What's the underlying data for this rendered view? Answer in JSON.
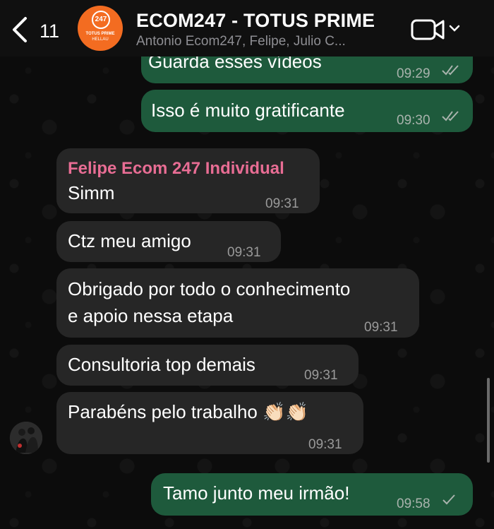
{
  "header": {
    "back_count": "11",
    "title": "ECOM247 - TOTUS PRIME",
    "subtitle": "Antonio Ecom247, Felipe, Julio C...",
    "avatar": {
      "logo_number": "247",
      "logo_line1": "TOTUS PRIME",
      "logo_line2": "HELLAU",
      "color": "#f36c21"
    },
    "icons": {
      "back": "chevron-left-icon",
      "video": "video-camera-icon",
      "menu": "chevron-down-icon"
    }
  },
  "colors": {
    "outgoing_bubble": "#1e5a3c",
    "incoming_bubble": "#262626",
    "sender_name": "#e86d94"
  },
  "messages": [
    {
      "direction": "out",
      "text": "Guarda esses vídeos",
      "time": "09:29",
      "status": "read"
    },
    {
      "direction": "out",
      "text": "Isso é muito gratificante",
      "time": "09:30",
      "status": "read"
    },
    {
      "direction": "in",
      "sender": "Felipe Ecom 247 Individual",
      "text": "Simm",
      "time": "09:31"
    },
    {
      "direction": "in",
      "text": "Ctz meu amigo",
      "time": "09:31"
    },
    {
      "direction": "in",
      "text_line1": "Obrigado por todo o conhecimento",
      "text_line2": "e apoio nessa etapa",
      "time": "09:31"
    },
    {
      "direction": "in",
      "text": "Consultoria top demais",
      "time": "09:31"
    },
    {
      "direction": "in",
      "text": "Parabéns pelo trabalho 👏🏻👏🏻",
      "time": "09:31"
    },
    {
      "direction": "out",
      "text": "Tamo junto meu irmão!",
      "time": "09:58",
      "status": "sent"
    }
  ]
}
